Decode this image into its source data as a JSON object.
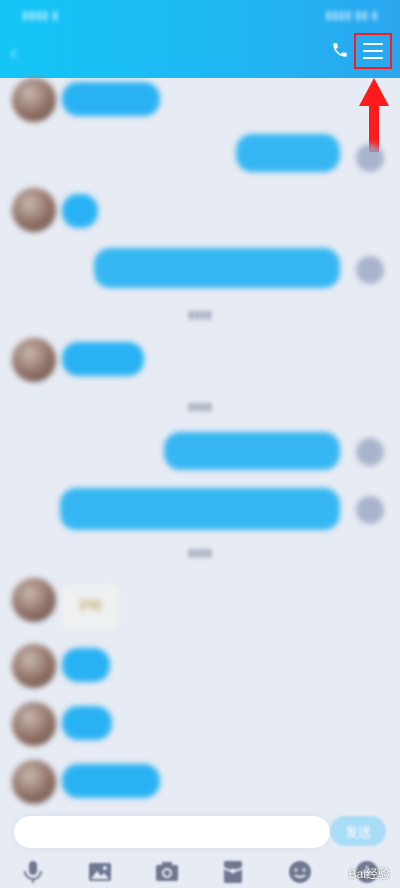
{
  "header": {
    "title": "",
    "phone_icon": "phone-icon",
    "menu_icon": "menu-icon",
    "accent": "#1fb8f3"
  },
  "annotation": {
    "highlight_color": "#ff1b1b"
  },
  "messages": [
    {
      "side": "in",
      "text": ""
    },
    {
      "side": "out",
      "text": ""
    },
    {
      "side": "in",
      "text": ""
    },
    {
      "side": "out",
      "text": ""
    },
    {
      "side": "in",
      "text": ""
    },
    {
      "side": "out",
      "text": ""
    },
    {
      "side": "out",
      "text": ""
    },
    {
      "side": "in",
      "image_text": "PR"
    },
    {
      "side": "in",
      "text": ""
    },
    {
      "side": "in",
      "text": ""
    },
    {
      "side": "in",
      "text": ""
    }
  ],
  "input": {
    "placeholder": "",
    "send_label": "发送"
  },
  "toolbar": {
    "icons": [
      "microphone-icon",
      "image-icon",
      "camera-icon",
      "red-packet-icon",
      "emoji-icon",
      "plus-icon"
    ]
  },
  "watermark": "Bai经验"
}
